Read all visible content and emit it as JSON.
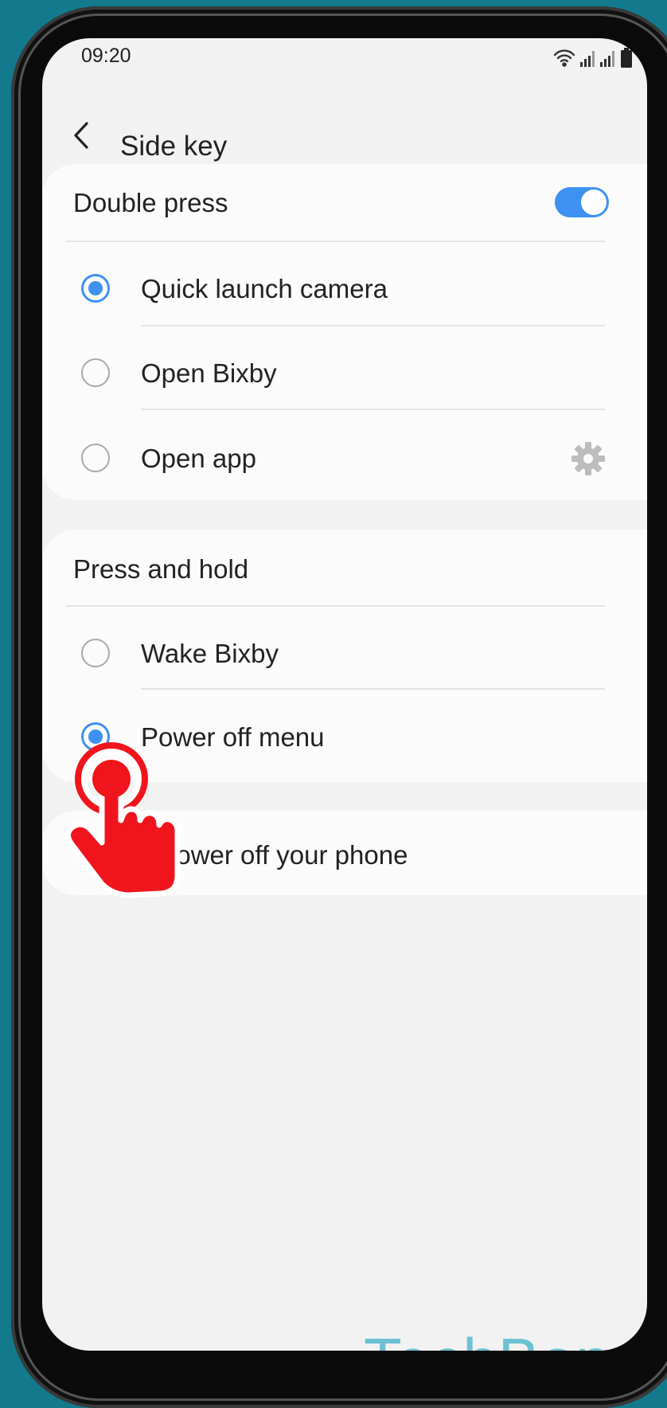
{
  "status_bar": {
    "time": "09:20",
    "icons": [
      "wifi-icon",
      "signal-icon",
      "signal-icon",
      "battery-icon"
    ]
  },
  "header": {
    "back_icon": "back-arrow-icon",
    "title": "Side key"
  },
  "double_press": {
    "title": "Double press",
    "toggle_on": true,
    "options": [
      {
        "label": "Quick launch camera",
        "selected": true
      },
      {
        "label": "Open Bixby",
        "selected": false
      },
      {
        "label": "Open app",
        "selected": false,
        "icon": "gear-icon"
      }
    ]
  },
  "press_and_hold": {
    "title": "Press and hold",
    "options": [
      {
        "label": "Wake Bixby",
        "selected": false
      },
      {
        "label": "Power off menu",
        "selected": true
      }
    ]
  },
  "hint": {
    "text": "power off your phone"
  },
  "overlay": {
    "icon": "tap-hand-icon",
    "watermark": "TechBone"
  },
  "colors": {
    "accent": "#3e91f0",
    "background": "#127a8c",
    "hand": "#f0141c",
    "watermark": "#6cc2d4"
  }
}
